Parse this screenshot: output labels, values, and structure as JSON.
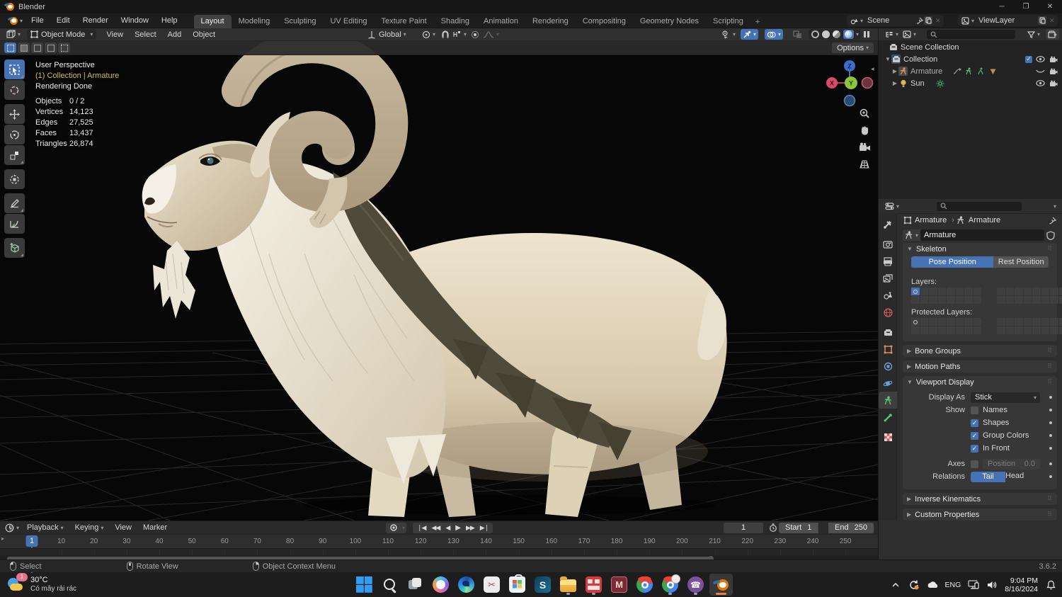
{
  "colors": {
    "accent": "#4772b3",
    "axis_x": "#e0455e",
    "axis_y": "#8bc53d",
    "axis_z": "#3b6fc9",
    "selection_text": "#cfc04d",
    "blender_orange": "#ea7600"
  },
  "window": {
    "app_title": "Blender"
  },
  "topbar": {
    "menus": [
      "File",
      "Edit",
      "Render",
      "Window",
      "Help"
    ],
    "workspaces": [
      "Layout",
      "Modeling",
      "Sculpting",
      "UV Editing",
      "Texture Paint",
      "Shading",
      "Animation",
      "Rendering",
      "Compositing",
      "Geometry Nodes",
      "Scripting"
    ],
    "active_workspace": "Layout",
    "add_workspace_label": "+",
    "scene_name": "Scene",
    "viewlayer_name": "ViewLayer"
  },
  "viewport_header": {
    "mode": "Object Mode",
    "menus": [
      "View",
      "Select",
      "Add",
      "Object"
    ],
    "orientation": "Global"
  },
  "tool_settings": {
    "options_label": "Options"
  },
  "viewport": {
    "overlay": {
      "view_name": "User Perspective",
      "context_path": "(1) Collection | Armature",
      "render_status": "Rendering Done",
      "stats": [
        {
          "label": "Objects",
          "value": "0 / 2"
        },
        {
          "label": "Vertices",
          "value": "14,123"
        },
        {
          "label": "Edges",
          "value": "27,525"
        },
        {
          "label": "Faces",
          "value": "13,437"
        },
        {
          "label": "Triangles",
          "value": "26,874"
        }
      ]
    },
    "gizmo": {
      "x_label": "X",
      "y_label": "Y",
      "z_label": "Z"
    }
  },
  "outliner": {
    "rows": [
      {
        "name": "Scene Collection"
      },
      {
        "name": "Collection"
      },
      {
        "name": "Armature"
      },
      {
        "name": "Sun"
      }
    ]
  },
  "properties": {
    "breadcrumb": {
      "object_name": "Armature",
      "data_name": "Armature"
    },
    "datablock_name": "Armature",
    "skeleton": {
      "title": "Skeleton",
      "pose_position": "Pose Position",
      "rest_position": "Rest Position",
      "layers_label": "Layers:",
      "protected_layers_label": "Protected Layers:"
    },
    "panels": {
      "bone_groups": "Bone Groups",
      "motion_paths": "Motion Paths",
      "viewport_display": "Viewport Display",
      "inverse_kinematics": "Inverse Kinematics",
      "custom_properties": "Custom Properties"
    },
    "viewport_display": {
      "display_as_label": "Display As",
      "display_as_value": "Stick",
      "show_label": "Show",
      "show_options": [
        {
          "label": "Names",
          "checked": false
        },
        {
          "label": "Shapes",
          "checked": true
        },
        {
          "label": "Group Colors",
          "checked": true
        },
        {
          "label": "In Front",
          "checked": true
        }
      ],
      "axes_label": "Axes",
      "position_label": "Position",
      "position_value": "0.0",
      "relations_label": "Relations",
      "tail_label": "Tail",
      "head_label": "Head"
    }
  },
  "timeline": {
    "menus": [
      "Playback",
      "Keying",
      "View",
      "Marker"
    ],
    "current_frame": "1",
    "start_label": "Start",
    "start_value": "1",
    "end_label": "End",
    "end_value": "250",
    "playhead_label": "1",
    "ruler_ticks": [
      10,
      20,
      30,
      40,
      50,
      60,
      70,
      80,
      90,
      100,
      110,
      120,
      130,
      140,
      150,
      160,
      170,
      180,
      190,
      200,
      210,
      220,
      230,
      240,
      250
    ]
  },
  "statusbar": {
    "hints": [
      {
        "label": "Select"
      },
      {
        "label": "Rotate View"
      },
      {
        "label": "Object Context Menu"
      }
    ],
    "version": "3.6.2"
  },
  "taskbar": {
    "weather": {
      "temp": "30°C",
      "condition": "Có mây rải rác",
      "badge": "1"
    },
    "icons": [
      {
        "name": "start"
      },
      {
        "name": "search"
      },
      {
        "name": "task-view"
      },
      {
        "name": "copilot"
      },
      {
        "name": "edge"
      },
      {
        "name": "snipping-tool"
      },
      {
        "name": "store"
      },
      {
        "name": "skype"
      },
      {
        "name": "file-explorer",
        "running": true
      },
      {
        "name": "unikey",
        "running": true
      },
      {
        "name": "m-app"
      },
      {
        "name": "chrome"
      },
      {
        "name": "chrome-profile",
        "running": true
      },
      {
        "name": "viber",
        "running": true
      },
      {
        "name": "blender",
        "active": true
      }
    ],
    "tray": {
      "language": "ENG",
      "time": "9:04 PM",
      "date": "8/16/2024"
    }
  }
}
